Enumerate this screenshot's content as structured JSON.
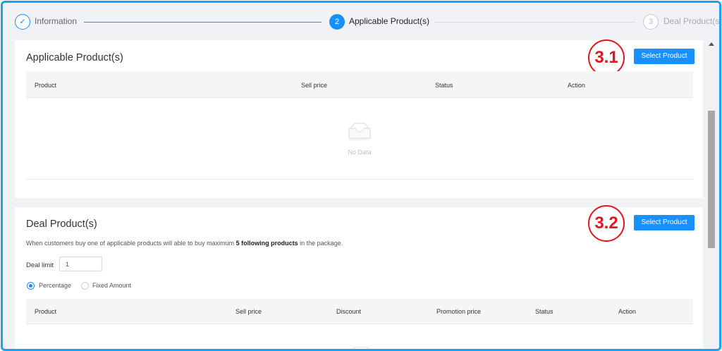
{
  "steps": [
    {
      "label": "Information",
      "state": "done",
      "marker": "✓"
    },
    {
      "label": "Applicable Product(s)",
      "state": "active",
      "marker": "2"
    },
    {
      "label": "Deal Product(s)",
      "state": "waiting",
      "marker": "3"
    }
  ],
  "applicable": {
    "title": "Applicable Product(s)",
    "select_label": "Select Product",
    "annotation": "3.1",
    "columns": [
      "Product",
      "Sell price",
      "Status",
      "Action"
    ],
    "empty_text": "No Data"
  },
  "deal": {
    "title": "Deal Product(s)",
    "select_label": "Select Product",
    "annotation": "3.2",
    "desc_prefix": "When customers buy one of applicable products will able to buy maximum ",
    "desc_bold": "5 following products",
    "desc_suffix": " in the package.",
    "limit_label": "Deal limit",
    "limit_value": "1",
    "radio_options": [
      {
        "label": "Percentage",
        "checked": true
      },
      {
        "label": "Fixed Amount",
        "checked": false
      }
    ],
    "columns": [
      "Product",
      "Sell price",
      "Discount",
      "Promotion price",
      "Status",
      "Action"
    ]
  },
  "colors": {
    "primary": "#1890ff",
    "frame_border": "#1aa1f0",
    "annotation": "#e8131b"
  },
  "icons": [
    "check-icon",
    "empty-inbox-icon",
    "scroll-up-arrow-icon"
  ]
}
